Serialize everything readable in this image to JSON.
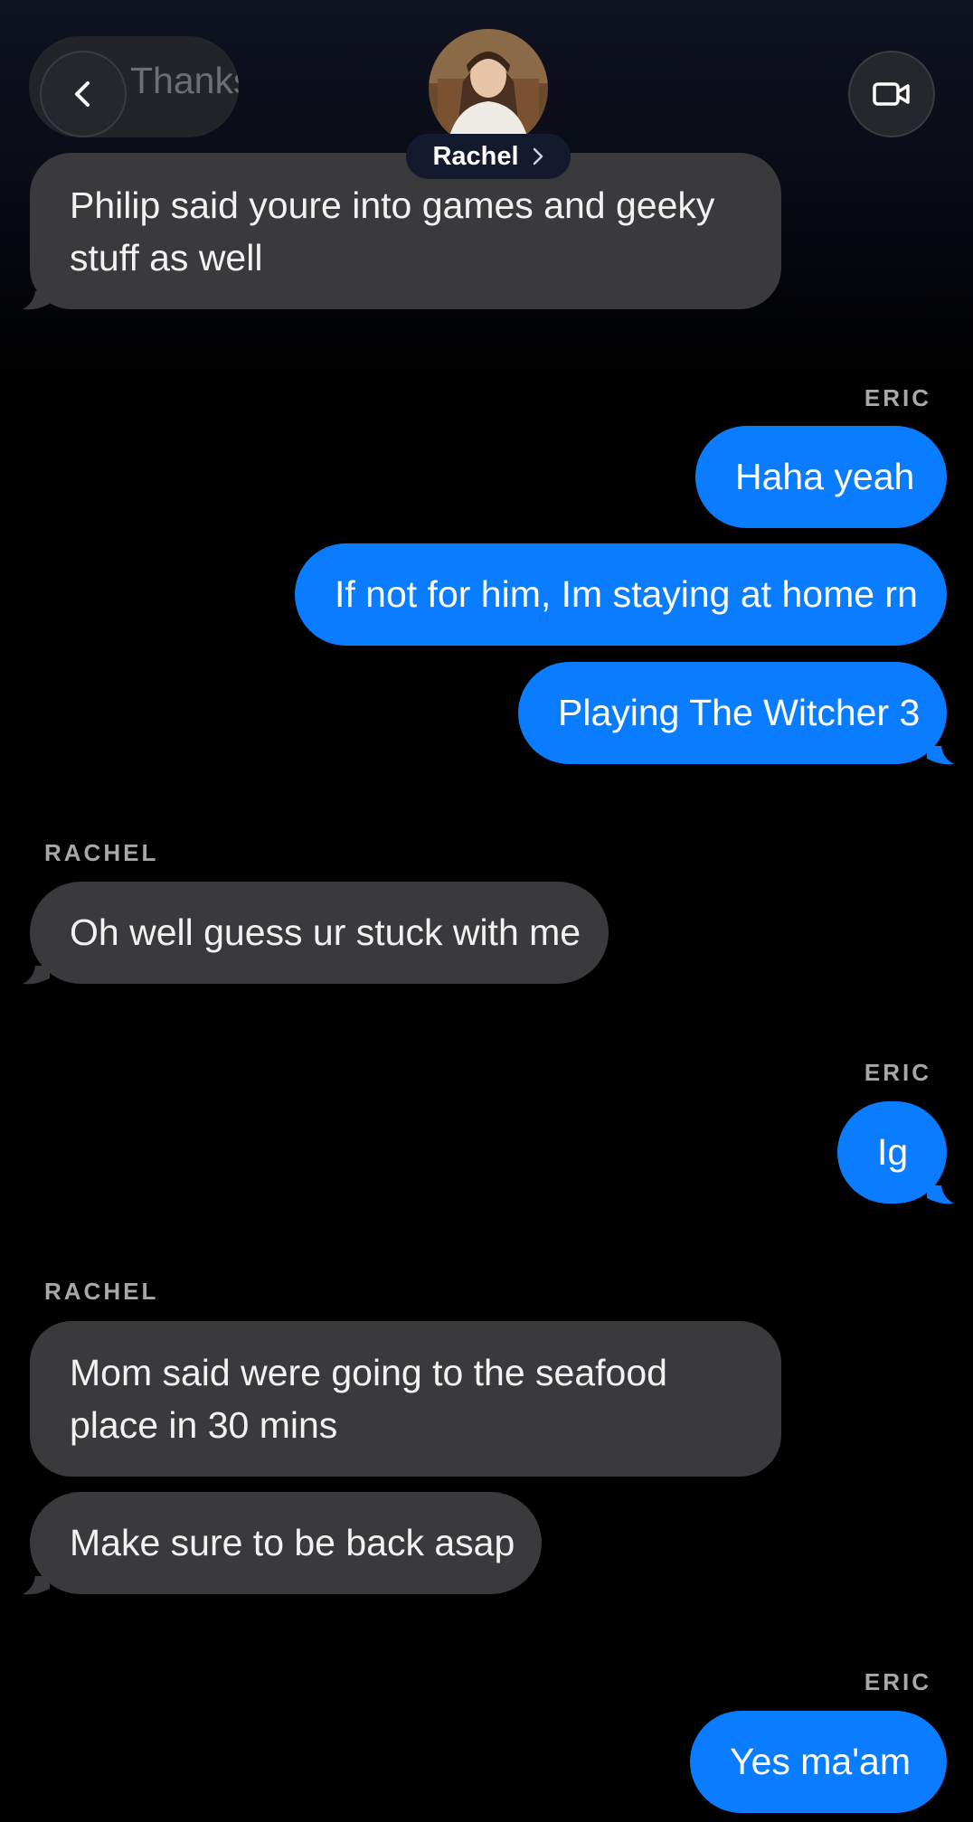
{
  "header": {
    "contact_name": "Rachel",
    "back_icon": "chevron-left-icon",
    "video_icon": "video-camera-icon",
    "chevron_icon": "chevron-right-icon"
  },
  "colors": {
    "incoming_bubble": "#3a3a3d",
    "outgoing_bubble": "#0a7cff",
    "background": "#000000",
    "sender_label": "#a8a8a8"
  },
  "messages": [
    {
      "id": "m0",
      "direction": "in",
      "text": "Thanks!",
      "partially_hidden": true
    },
    {
      "id": "m1",
      "direction": "in",
      "lines": [
        "Philip said youre into games and geeky",
        "stuff as well"
      ]
    },
    {
      "id": "l1",
      "sender_label": "ERIC"
    },
    {
      "id": "m2",
      "direction": "out",
      "text": "Haha yeah"
    },
    {
      "id": "m3",
      "direction": "out",
      "text": "If not for him, Im staying at home rn"
    },
    {
      "id": "m4",
      "direction": "out",
      "text": "Playing The Witcher 3"
    },
    {
      "id": "l2",
      "sender_label": "RACHEL"
    },
    {
      "id": "m5",
      "direction": "in",
      "text": "Oh well guess ur stuck with me"
    },
    {
      "id": "l3",
      "sender_label": "ERIC"
    },
    {
      "id": "m6",
      "direction": "out",
      "text": "Ig"
    },
    {
      "id": "l4",
      "sender_label": "RACHEL"
    },
    {
      "id": "m7",
      "direction": "in",
      "lines": [
        "Mom said were going to the seafood",
        "place in 30 mins"
      ]
    },
    {
      "id": "m8",
      "direction": "in",
      "text": "Make sure to be back asap"
    },
    {
      "id": "l5",
      "sender_label": "ERIC"
    },
    {
      "id": "m9",
      "direction": "out",
      "text": "Yes ma'am"
    }
  ]
}
